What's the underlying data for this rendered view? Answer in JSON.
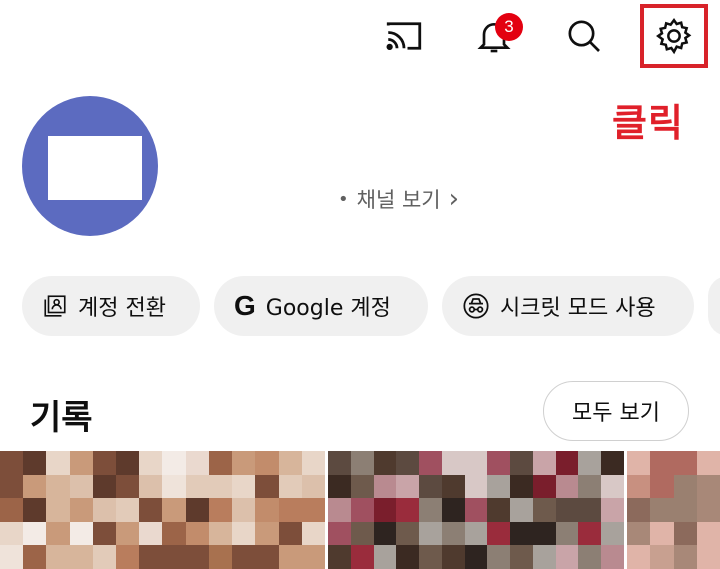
{
  "header": {
    "notification_count": "3",
    "icons": [
      "cast-icon",
      "bell-icon",
      "search-icon",
      "settings-gear-icon"
    ]
  },
  "annotation": {
    "click_label": "클릭",
    "highlight_color": "#d8232a"
  },
  "profile": {
    "avatar_color": "#5c6bc0",
    "channel_link_label": "채널 보기",
    "channel_link_chevron": "›"
  },
  "chips": [
    {
      "label": "계정 전환",
      "icon": "switch-account-icon"
    },
    {
      "label": "Google 계정",
      "icon": "google-g-icon",
      "icon_text": "G"
    },
    {
      "label": "시크릿 모드 사용",
      "icon": "incognito-icon"
    }
  ],
  "history": {
    "title": "기록",
    "view_all_label": "모두 보기"
  },
  "colors": {
    "badge": "#e30010",
    "chip_bg": "#f0f0f0",
    "secondary_text": "#606060"
  }
}
